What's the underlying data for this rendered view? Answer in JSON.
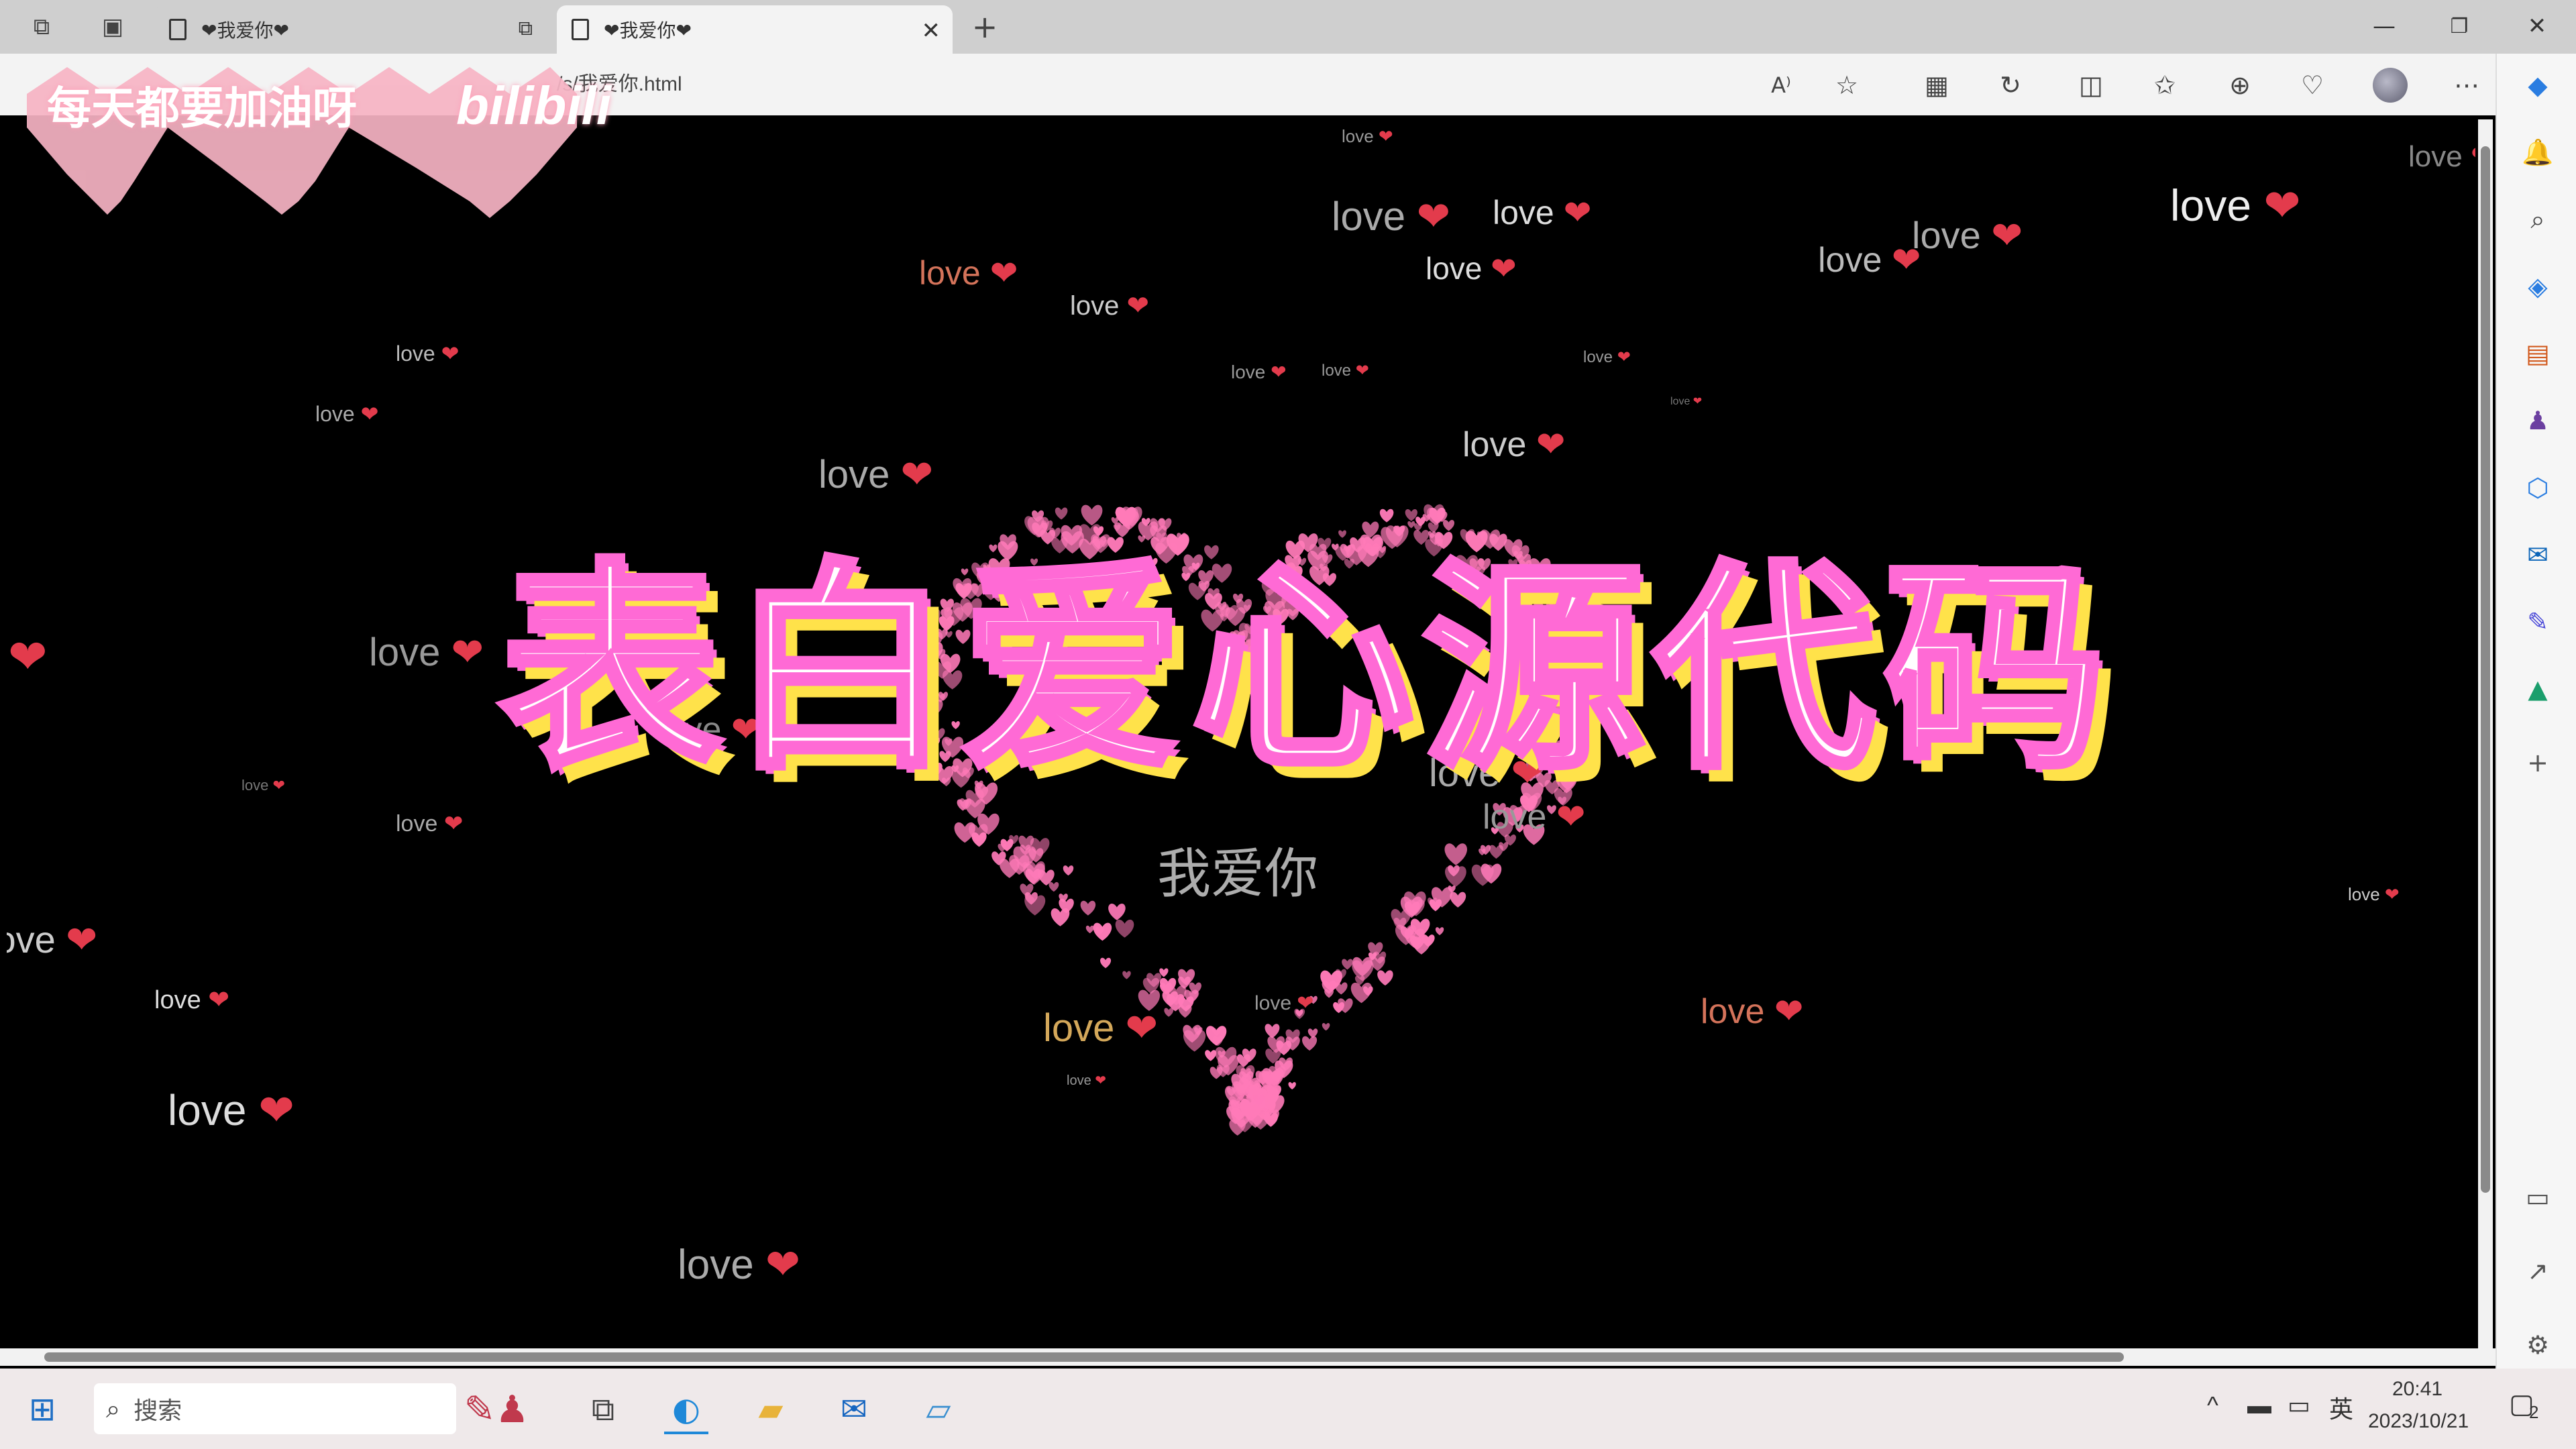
{
  "tabs": [
    {
      "title": "❤我爱你❤",
      "active": false
    },
    {
      "title": "❤我爱你❤",
      "active": true
    }
  ],
  "new_tab_label": "+",
  "address_bar": {
    "url": "/s/我爱你.html"
  },
  "page": {
    "background": "#000000",
    "heart_color": "#ff7ab8",
    "center_text": "我爱你",
    "love_word": "love",
    "heart_glyph": "❤"
  },
  "overlay": {
    "title": "表白爱心源代码",
    "cheer": "每天都要加油呀",
    "brand": "bilibili",
    "title_fill": "#ffffff",
    "title_outline": "#ff6ad5",
    "title_shadow": "#ffe24a"
  },
  "taskbar": {
    "search_placeholder": "搜索",
    "ime": "英",
    "time": "20:41",
    "date": "2023/10/21",
    "notification_count": "2"
  }
}
